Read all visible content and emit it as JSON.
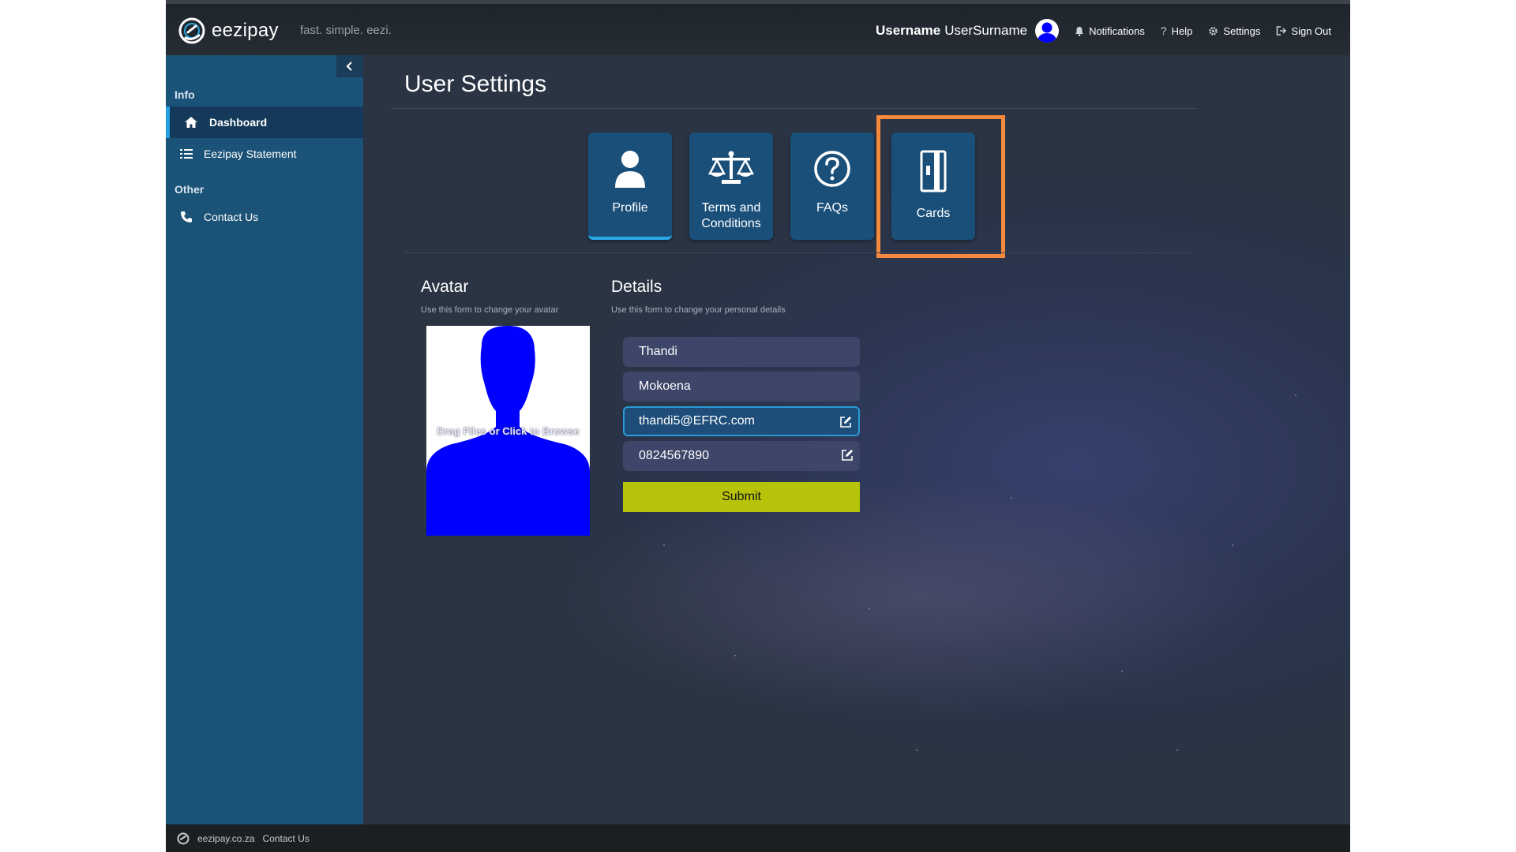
{
  "header": {
    "brand": "eezipay",
    "tagline": "fast. simple. eezi.",
    "user_first": "Username",
    "user_last": "UserSurname",
    "links": {
      "notifications": "Notifications",
      "help": "Help",
      "settings": "Settings",
      "signout": "Sign Out"
    }
  },
  "sidebar": {
    "sections": [
      "Info",
      "Other"
    ],
    "items": [
      {
        "label": "Dashboard",
        "icon": "home-icon",
        "active": true
      },
      {
        "label": "Eezipay Statement",
        "icon": "list-icon"
      },
      {
        "label": "Contact Us",
        "icon": "phone-icon"
      }
    ]
  },
  "main": {
    "title": "User Settings",
    "tabs": [
      {
        "label": "Profile",
        "icon": "user-icon",
        "active": true
      },
      {
        "label": "Terms and",
        "label2": "Conditions",
        "icon": "scales-icon"
      },
      {
        "label": "FAQs",
        "icon": "question-circle-icon"
      },
      {
        "label": "Cards",
        "icon": "card-icon",
        "highlighted": true
      }
    ],
    "avatar": {
      "title": "Avatar",
      "subtitle": "Use this form to change your avatar",
      "drop_text": "Drag Files or Click to Browse"
    },
    "details": {
      "title": "Details",
      "subtitle": "Use this form to change your personal details",
      "first_name": "Thandi",
      "last_name": "Mokoena",
      "email": "thandi5@EFRC.com",
      "phone": "0824567890",
      "submit_label": "Submit"
    }
  },
  "footer": {
    "site": "eezipay.co.za",
    "contact": "Contact Us"
  },
  "colors": {
    "sidebar": "#1b5277",
    "tab_bg": "#1a4f7a",
    "highlight": "#f5893c",
    "submit": "#b7c20a",
    "avatar_silhouette": "#0000ff"
  }
}
